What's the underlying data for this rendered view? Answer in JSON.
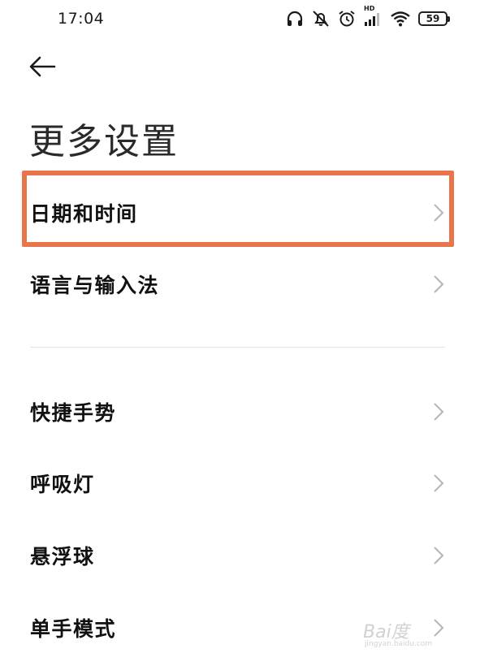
{
  "status_bar": {
    "time": "17:04",
    "battery": "59",
    "network_label": "HD",
    "icons": [
      "headphones-icon",
      "mute-icon",
      "alarm-icon",
      "hd-signal-icon",
      "wifi-icon",
      "battery-icon"
    ]
  },
  "header": {
    "back_icon": "back-arrow-icon",
    "title": "更多设置"
  },
  "menu": {
    "items": [
      {
        "label": "日期和时间",
        "highlighted": true
      },
      {
        "label": "语言与输入法"
      },
      {
        "label": "快捷手势"
      },
      {
        "label": "呼吸灯"
      },
      {
        "label": "悬浮球"
      },
      {
        "label": "单手模式"
      }
    ]
  },
  "colors": {
    "highlight": "#e8764a",
    "chevron": "#b5b5b5",
    "divider": "#e4e4e4"
  },
  "watermark": {
    "brand": "Bai度",
    "domain": "jingyan.baidu.com"
  }
}
